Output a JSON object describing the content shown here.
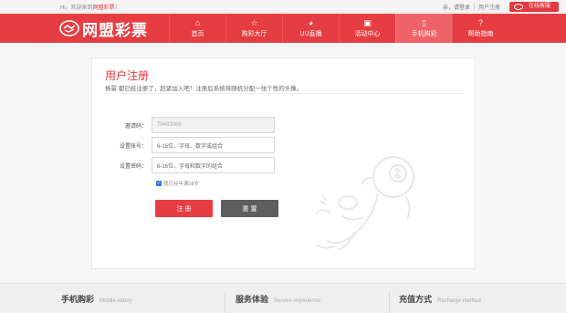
{
  "topbar": {
    "welcome_prefix": "Hi，欢迎来到",
    "welcome_brand": "网盟彩票",
    "welcome_suffix": "！",
    "login_text": "亲，请登录",
    "register_text": "用户注册",
    "service_label": "在线客服"
  },
  "header": {
    "logo_text": "网盟彩票",
    "nav": [
      {
        "label": "首页",
        "icon": "home-icon",
        "glyph": "⌂"
      },
      {
        "label": "购彩大厅",
        "icon": "star-icon",
        "glyph": "☆"
      },
      {
        "label": "UU直播",
        "icon": "cat-icon",
        "glyph": "◕"
      },
      {
        "label": "活动中心",
        "icon": "gift-icon",
        "glyph": "▣"
      },
      {
        "label": "手机购彩",
        "icon": "phone-icon",
        "glyph": "▯",
        "active": true
      },
      {
        "label": "帮助指南",
        "icon": "help-icon",
        "glyph": "?"
      }
    ]
  },
  "register": {
    "title": "用户注册",
    "subtitle": "杨幂 都已经注册了，赶紧加入吧！注册后系统将随机分配一张个性的头像。",
    "invite_label": "邀请码：",
    "invite_value": "76483068",
    "account_label": "设置账号：",
    "account_placeholder": "6-16位，字母、数字或组合",
    "password_label": "设置密码：",
    "password_placeholder": "6-16位，字母和数字的组合",
    "agree_text": "我已经年满18岁",
    "submit_label": "注 册",
    "reset_label": "重 置"
  },
  "footer": {
    "cols": [
      {
        "cn": "手机购彩",
        "en": "Mobile lottery"
      },
      {
        "cn": "服务体验",
        "en": "Service experience"
      },
      {
        "cn": "充值方式",
        "en": "Recharge method"
      }
    ]
  },
  "colors": {
    "brand_red": "#e53d42",
    "active_nav": "#ef6267",
    "checkbox_blue": "#3477e0"
  }
}
